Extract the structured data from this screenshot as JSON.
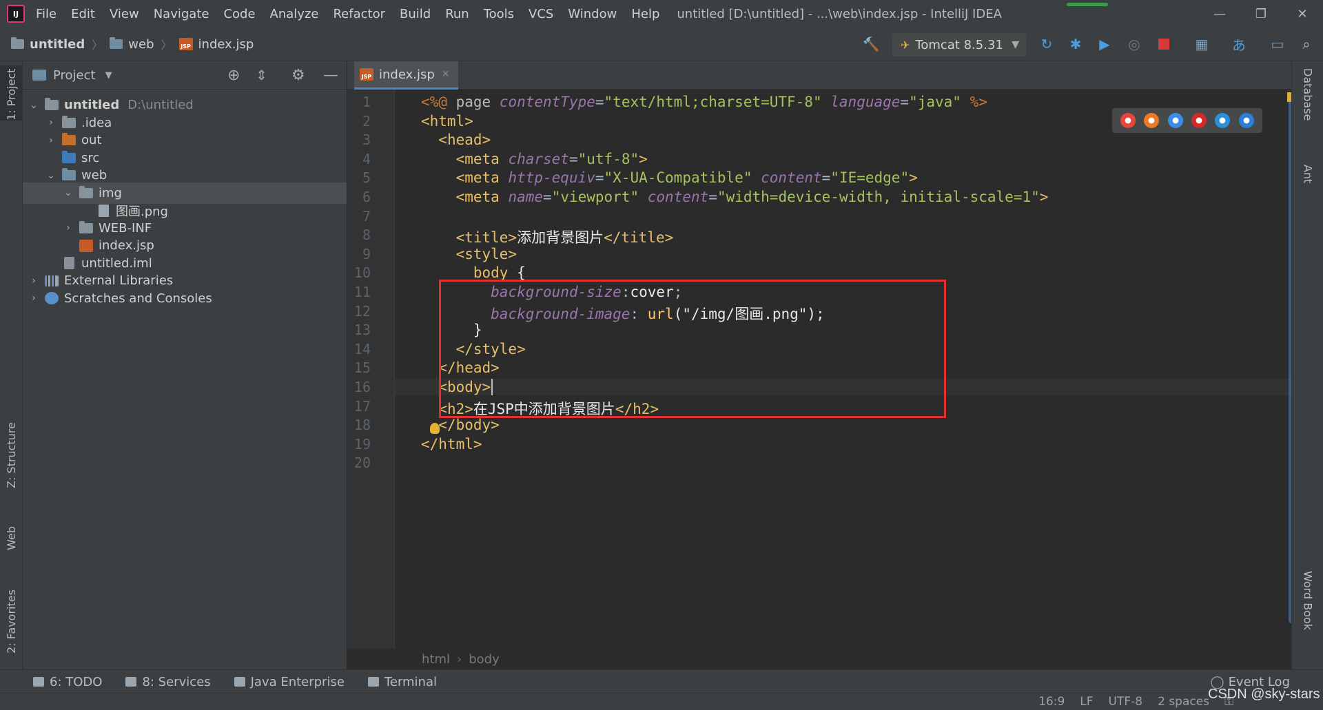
{
  "window": {
    "title": "untitled [D:\\untitled] - ...\\web\\index.jsp - IntelliJ IDEA",
    "logo_text": "IJ",
    "menu": [
      "File",
      "Edit",
      "View",
      "Navigate",
      "Code",
      "Analyze",
      "Refactor",
      "Build",
      "Run",
      "Tools",
      "VCS",
      "Window",
      "Help"
    ],
    "controls": {
      "minimize": "—",
      "restore": "❐",
      "close": "✕"
    },
    "progress": 1.0
  },
  "navbar": {
    "crumbs": [
      "untitled",
      "web",
      "index.jsp"
    ],
    "run_config": "Tomcat 8.5.31"
  },
  "left_strip": {
    "tabs": [
      "1: Project",
      "Z: Structure",
      "Web",
      "2: Favorites"
    ]
  },
  "right_strip": {
    "tabs": [
      "Database",
      "Ant",
      "Word Book"
    ]
  },
  "project_panel": {
    "title": "Project",
    "tree": [
      {
        "label": "untitled",
        "path": "D:\\untitled",
        "icon": "project-folder-icon",
        "chev": "v",
        "indent": 0
      },
      {
        "label": ".idea",
        "icon": "folder-icon",
        "chev": ">",
        "indent": 1
      },
      {
        "label": "out",
        "icon": "orange-folder-icon",
        "chev": ">",
        "indent": 1
      },
      {
        "label": "src",
        "icon": "source-folder-icon",
        "chev": "",
        "indent": 1
      },
      {
        "label": "web",
        "icon": "web-folder-icon",
        "chev": "v",
        "indent": 1
      },
      {
        "label": "img",
        "icon": "folder-icon",
        "chev": "v",
        "indent": 2,
        "selected": true
      },
      {
        "label": "图画.png",
        "icon": "image-file-icon",
        "chev": "",
        "indent": 3
      },
      {
        "label": "WEB-INF",
        "icon": "folder-icon",
        "chev": ">",
        "indent": 2
      },
      {
        "label": "index.jsp",
        "icon": "jsp-file-icon",
        "chev": "",
        "indent": 2
      },
      {
        "label": "untitled.iml",
        "icon": "module-file-icon",
        "chev": "",
        "indent": 1
      },
      {
        "label": "External Libraries",
        "icon": "library-icon",
        "chev": ">",
        "indent": 0
      },
      {
        "label": "Scratches and Consoles",
        "icon": "scratches-icon",
        "chev": ">",
        "indent": 0
      }
    ]
  },
  "editor": {
    "tab": {
      "label": "index.jsp",
      "close": "✕"
    },
    "current_line": 16,
    "lines": [
      [
        {
          "c": "t-dir",
          "t": "<%@ "
        },
        {
          "c": "t-attr",
          "t": "page "
        },
        {
          "c": "t-ital",
          "t": "contentType"
        },
        {
          "c": "t-val",
          "t": "="
        },
        {
          "c": "t-str",
          "t": "\"text/html;charset=UTF-8\""
        },
        {
          "c": "t-val",
          "t": " "
        },
        {
          "c": "t-ital",
          "t": "language"
        },
        {
          "c": "t-val",
          "t": "="
        },
        {
          "c": "t-str",
          "t": "\"java\""
        },
        {
          "c": "t-dir",
          "t": " %>"
        }
      ],
      [
        {
          "c": "t-ang",
          "t": "<html>"
        }
      ],
      [
        {
          "c": "t-val",
          "t": "  "
        },
        {
          "c": "t-ang",
          "t": "<head>"
        }
      ],
      [
        {
          "c": "t-val",
          "t": "    "
        },
        {
          "c": "t-ang",
          "t": "<meta "
        },
        {
          "c": "t-ital",
          "t": "charset"
        },
        {
          "c": "t-val",
          "t": "="
        },
        {
          "c": "t-str",
          "t": "\"utf-8\""
        },
        {
          "c": "t-ang",
          "t": ">"
        }
      ],
      [
        {
          "c": "t-val",
          "t": "    "
        },
        {
          "c": "t-ang",
          "t": "<meta "
        },
        {
          "c": "t-ital",
          "t": "http-equiv"
        },
        {
          "c": "t-val",
          "t": "="
        },
        {
          "c": "t-str",
          "t": "\"X-UA-Compatible\""
        },
        {
          "c": "t-val",
          "t": " "
        },
        {
          "c": "t-ital",
          "t": "content"
        },
        {
          "c": "t-val",
          "t": "="
        },
        {
          "c": "t-str",
          "t": "\"IE=edge\""
        },
        {
          "c": "t-ang",
          "t": ">"
        }
      ],
      [
        {
          "c": "t-val",
          "t": "    "
        },
        {
          "c": "t-ang",
          "t": "<meta "
        },
        {
          "c": "t-ital",
          "t": "name"
        },
        {
          "c": "t-val",
          "t": "="
        },
        {
          "c": "t-str",
          "t": "\"viewport\""
        },
        {
          "c": "t-val",
          "t": " "
        },
        {
          "c": "t-ital",
          "t": "content"
        },
        {
          "c": "t-val",
          "t": "="
        },
        {
          "c": "t-str",
          "t": "\"width=device-width, initial-scale=1\""
        },
        {
          "c": "t-ang",
          "t": ">"
        }
      ],
      [],
      [
        {
          "c": "t-val",
          "t": "    "
        },
        {
          "c": "t-ang",
          "t": "<title>"
        },
        {
          "c": "t-bright",
          "t": "添加背景图片"
        },
        {
          "c": "t-ang",
          "t": "</title>"
        }
      ],
      [
        {
          "c": "t-val",
          "t": "    "
        },
        {
          "c": "t-ang",
          "t": "<style>"
        }
      ],
      [
        {
          "c": "t-val",
          "t": "      "
        },
        {
          "c": "t-sel",
          "t": "body "
        },
        {
          "c": "t-bright",
          "t": "{"
        }
      ],
      [
        {
          "c": "t-val",
          "t": "        "
        },
        {
          "c": "t-prop",
          "t": "background-size"
        },
        {
          "c": "t-val",
          "t": ":"
        },
        {
          "c": "t-bright",
          "t": "cover"
        },
        {
          "c": "t-val",
          "t": ";"
        }
      ],
      [
        {
          "c": "t-val",
          "t": "        "
        },
        {
          "c": "t-prop",
          "t": "background-image"
        },
        {
          "c": "t-val",
          "t": ": "
        },
        {
          "c": "t-fn",
          "t": "url"
        },
        {
          "c": "t-bright",
          "t": "(\"/img/图画.png\");"
        }
      ],
      [
        {
          "c": "t-val",
          "t": "      "
        },
        {
          "c": "t-bright",
          "t": "}"
        }
      ],
      [
        {
          "c": "t-val",
          "t": "    "
        },
        {
          "c": "t-ang",
          "t": "</style>"
        }
      ],
      [
        {
          "c": "t-val",
          "t": "  "
        },
        {
          "c": "t-ang",
          "t": "</head>"
        }
      ],
      [
        {
          "c": "t-val",
          "t": "  "
        },
        {
          "c": "t-ang",
          "t": "<body>"
        }
      ],
      [
        {
          "c": "t-val",
          "t": "  "
        },
        {
          "c": "t-ang",
          "t": "<h2>"
        },
        {
          "c": "t-bright",
          "t": "在JSP中添加背景图片"
        },
        {
          "c": "t-ang",
          "t": "</h2>"
        }
      ],
      [
        {
          "c": "t-val",
          "t": "  "
        },
        {
          "c": "t-ang",
          "t": "</body>"
        }
      ],
      [
        {
          "c": "t-ang",
          "t": "</html>"
        }
      ],
      []
    ],
    "breadcrumb": [
      "html",
      "body"
    ],
    "browsers": [
      {
        "name": "chrome-icon",
        "color": "#e8453c"
      },
      {
        "name": "firefox-icon",
        "color": "#f07a22"
      },
      {
        "name": "safari-icon",
        "color": "#3b8ee8"
      },
      {
        "name": "opera-icon",
        "color": "#d62a2a"
      },
      {
        "name": "ie-icon",
        "color": "#2b90d9"
      },
      {
        "name": "edge-icon",
        "color": "#2e7fd6"
      }
    ]
  },
  "bottom_bar": {
    "tabs": [
      "6: TODO",
      "8: Services",
      "Java Enterprise",
      "Terminal"
    ],
    "event_log": "Event Log"
  },
  "status_bar": {
    "position": "16:9",
    "line_sep": "LF",
    "encoding": "UTF-8",
    "indent": "2 spaces"
  },
  "watermark": "CSDN @sky-stars",
  "colors": {
    "accent": "#4a88c7",
    "highlight_box": "#e03030",
    "background": "#2b2b2b"
  }
}
